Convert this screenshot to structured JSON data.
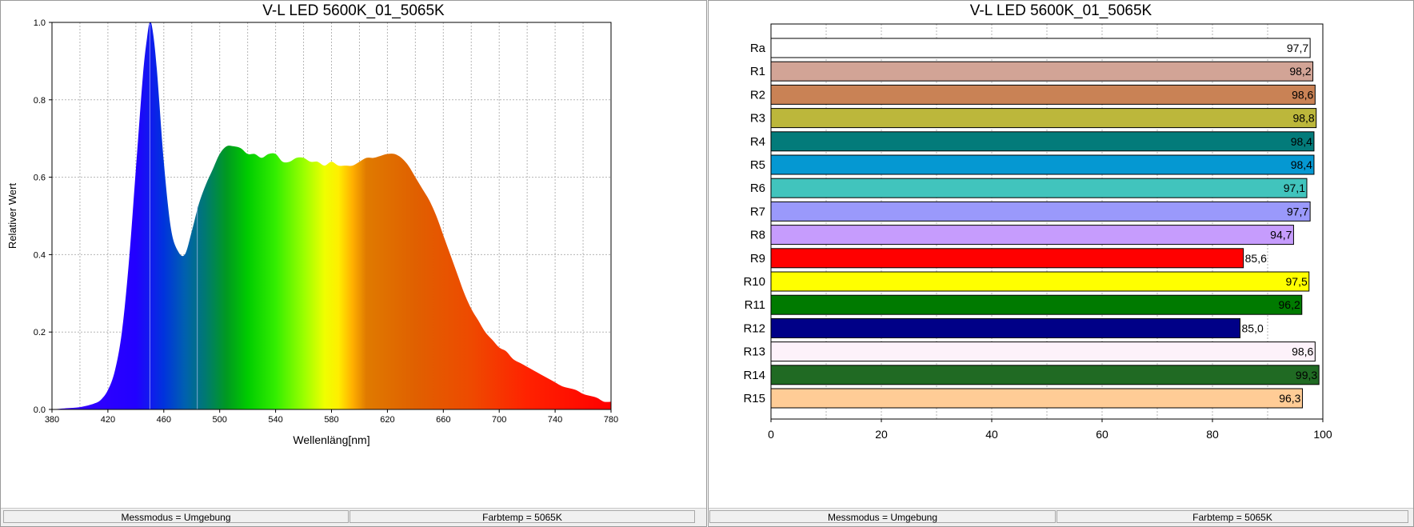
{
  "chart_data": [
    {
      "type": "area",
      "title": "V-L LED 5600K_01_5065K",
      "xlabel": "Wellenläng[nm]",
      "ylabel": "Relativer Wert",
      "xlim": [
        380,
        780
      ],
      "ylim": [
        0,
        1.0
      ],
      "x_ticks": [
        "380",
        "420",
        "460",
        "500",
        "540",
        "580",
        "620",
        "660",
        "700",
        "740",
        "780"
      ],
      "y_ticks": [
        "0.0",
        "0.2",
        "0.4",
        "0.6",
        "0.8",
        "1.0"
      ],
      "grid": true,
      "x": [
        380,
        390,
        400,
        410,
        415,
        420,
        425,
        430,
        435,
        440,
        445,
        448,
        450,
        452,
        455,
        460,
        465,
        470,
        475,
        480,
        485,
        490,
        495,
        500,
        505,
        510,
        515,
        520,
        525,
        530,
        535,
        540,
        545,
        550,
        555,
        560,
        565,
        570,
        575,
        580,
        585,
        590,
        595,
        600,
        605,
        610,
        615,
        620,
        625,
        630,
        635,
        640,
        645,
        650,
        655,
        660,
        665,
        670,
        675,
        680,
        685,
        690,
        695,
        700,
        705,
        710,
        715,
        720,
        725,
        730,
        735,
        740,
        745,
        750,
        755,
        760,
        765,
        770,
        775,
        780
      ],
      "y": [
        0.0,
        0.003,
        0.006,
        0.015,
        0.025,
        0.05,
        0.1,
        0.2,
        0.38,
        0.62,
        0.86,
        0.96,
        1.0,
        0.98,
        0.88,
        0.64,
        0.47,
        0.41,
        0.4,
        0.46,
        0.53,
        0.58,
        0.62,
        0.66,
        0.68,
        0.68,
        0.675,
        0.66,
        0.66,
        0.65,
        0.66,
        0.66,
        0.64,
        0.64,
        0.65,
        0.65,
        0.64,
        0.64,
        0.63,
        0.64,
        0.63,
        0.63,
        0.63,
        0.64,
        0.65,
        0.65,
        0.655,
        0.66,
        0.66,
        0.65,
        0.63,
        0.6,
        0.57,
        0.54,
        0.5,
        0.45,
        0.4,
        0.35,
        0.3,
        0.26,
        0.23,
        0.2,
        0.18,
        0.16,
        0.15,
        0.13,
        0.12,
        0.11,
        0.1,
        0.09,
        0.08,
        0.07,
        0.06,
        0.055,
        0.05,
        0.04,
        0.035,
        0.03,
        0.02,
        0.02
      ],
      "markers": [
        450,
        484
      ]
    },
    {
      "type": "bar",
      "orientation": "horizontal",
      "title": "V-L LED 5600K_01_5065K",
      "xlim": [
        0,
        100
      ],
      "x_ticks": [
        "0",
        "20",
        "40",
        "60",
        "80",
        "100"
      ],
      "grid": true,
      "categories": [
        "Ra",
        "R1",
        "R2",
        "R3",
        "R4",
        "R5",
        "R6",
        "R7",
        "R8",
        "R9",
        "R10",
        "R11",
        "R12",
        "R13",
        "R14",
        "R15"
      ],
      "values": [
        97.7,
        98.2,
        98.6,
        98.8,
        98.4,
        98.4,
        97.1,
        97.7,
        94.7,
        85.6,
        97.5,
        96.2,
        85.0,
        98.6,
        99.3,
        96.3
      ],
      "value_labels": [
        "97,7",
        "98,2",
        "98,6",
        "98,8",
        "98,4",
        "98,4",
        "97,1",
        "97,7",
        "94,7",
        "85,6",
        "97,5",
        "96,2",
        "85,0",
        "98,6",
        "99,3",
        "96,3"
      ],
      "colors": [
        "#ffffff",
        "#d2a496",
        "#c98255",
        "#bcb73b",
        "#037b7a",
        "#0598d2",
        "#41c4bd",
        "#9a99fb",
        "#c69cfd",
        "#ff0000",
        "#ffff00",
        "#007a00",
        "#000087",
        "#fdf2fa",
        "#206a23",
        "#ffcc96"
      ]
    }
  ],
  "status": {
    "left_mode": "Messmodus = Umgebung",
    "left_temp": "Farbtemp = 5065K",
    "right_mode": "Messmodus = Umgebung",
    "right_temp": "Farbtemp = 5065K"
  }
}
